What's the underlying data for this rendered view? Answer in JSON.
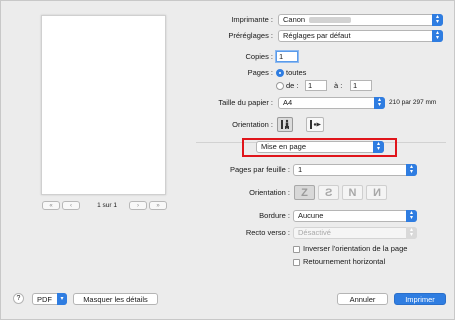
{
  "preview": {
    "page_counter": "1 sur 1",
    "first_glyph": "«",
    "prev_glyph": "‹",
    "next_glyph": "›",
    "last_glyph": "»"
  },
  "printer": {
    "label": "Imprimante :",
    "value": "Canon"
  },
  "presets": {
    "label": "Préréglages :",
    "value": "Réglages par défaut"
  },
  "copies": {
    "label": "Copies :",
    "value": "1"
  },
  "pages": {
    "label": "Pages :",
    "all_label": "toutes",
    "from_label": "de :",
    "from_value": "1",
    "to_label": "à :",
    "to_value": "1",
    "selected": "all"
  },
  "paper_size": {
    "label": "Taille du papier :",
    "value": "A4",
    "dimensions": "210 par 297 mm"
  },
  "orientation": {
    "label": "Orientation :",
    "selected": "portrait"
  },
  "section_popup": {
    "value": "Mise en page"
  },
  "layout": {
    "pages_per_sheet_label": "Pages par feuille :",
    "pages_per_sheet_value": "1",
    "direction_label": "Orientation :",
    "direction_glyphs": [
      "Z",
      "S",
      "N",
      "N"
    ],
    "border_label": "Bordure :",
    "border_value": "Aucune",
    "two_sided_label": "Recto verso :",
    "two_sided_value": "Désactivé",
    "reverse_orientation_label": "Inverser l'orientation de la page",
    "flip_horizontal_label": "Retournement horizontal"
  },
  "footer": {
    "help_glyph": "?",
    "pdf_label": "PDF",
    "hide_details_label": "Masquer les détails",
    "cancel_label": "Annuler",
    "print_label": "Imprimer"
  },
  "colors": {
    "accent": "#2f7de1",
    "highlight_box": "#e0151b"
  }
}
